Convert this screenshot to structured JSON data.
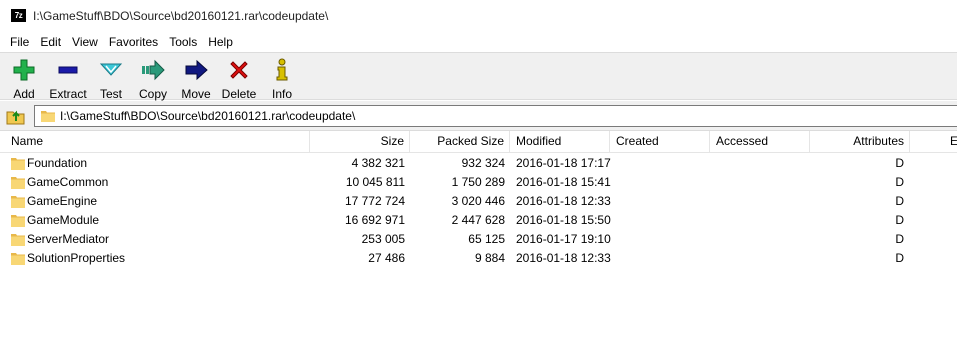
{
  "window": {
    "app_icon_text": "7z",
    "title": "I:\\GameStuff\\BDO\\Source\\bd20160121.rar\\codeupdate\\"
  },
  "menu": [
    "File",
    "Edit",
    "View",
    "Favorites",
    "Tools",
    "Help"
  ],
  "toolbar": {
    "add": "Add",
    "extract": "Extract",
    "test": "Test",
    "copy": "Copy",
    "move": "Move",
    "delete": "Delete",
    "info": "Info"
  },
  "colors": {
    "add": "#22b14c",
    "extract": "#1a1aa8",
    "test": "#3cc8d8",
    "copy": "#2a9a7a",
    "move": "#101880",
    "delete": "#e01010",
    "info": "#d8c000",
    "folder": "#f8d775"
  },
  "address": {
    "path": "I:\\GameStuff\\BDO\\Source\\bd20160121.rar\\codeupdate\\"
  },
  "columns": {
    "name": "Name",
    "size": "Size",
    "packed": "Packed Size",
    "modified": "Modified",
    "created": "Created",
    "accessed": "Accessed",
    "attributes": "Attributes",
    "extra": "E"
  },
  "files": [
    {
      "name": "Foundation",
      "size": "4 382 321",
      "packed": "932 324",
      "modified": "2016-01-18 17:17",
      "attr": "D"
    },
    {
      "name": "GameCommon",
      "size": "10 045 811",
      "packed": "1 750 289",
      "modified": "2016-01-18 15:41",
      "attr": "D"
    },
    {
      "name": "GameEngine",
      "size": "17 772 724",
      "packed": "3 020 446",
      "modified": "2016-01-18 12:33",
      "attr": "D"
    },
    {
      "name": "GameModule",
      "size": "16 692 971",
      "packed": "2 447 628",
      "modified": "2016-01-18 15:50",
      "attr": "D"
    },
    {
      "name": "ServerMediator",
      "size": "253 005",
      "packed": "65 125",
      "modified": "2016-01-17 19:10",
      "attr": "D"
    },
    {
      "name": "SolutionProperties",
      "size": "27 486",
      "packed": "9 884",
      "modified": "2016-01-18 12:33",
      "attr": "D"
    }
  ]
}
